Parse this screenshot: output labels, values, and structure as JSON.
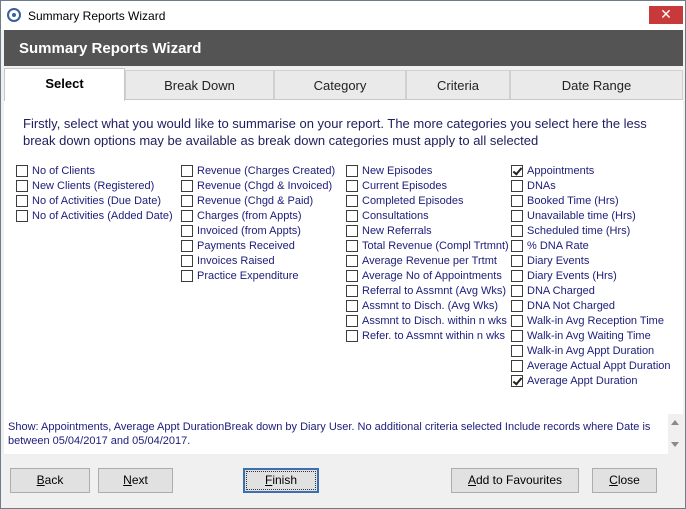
{
  "window": {
    "title": "Summary Reports Wizard",
    "close_glyph": "✕"
  },
  "header": {
    "title": "Summary Reports Wizard"
  },
  "tabs": [
    {
      "label": "Select",
      "active": true
    },
    {
      "label": "Break Down",
      "active": false
    },
    {
      "label": "Category",
      "active": false
    },
    {
      "label": "Criteria",
      "active": false
    },
    {
      "label": "Date Range",
      "active": false
    }
  ],
  "intro": "Firstly, select what you would like to summarise on your report. The more categories you select here the less break down options may be available as break down categories must apply to all selected",
  "columns": [
    [
      {
        "label": "No of Clients",
        "checked": false
      },
      {
        "label": "New Clients (Registered)",
        "checked": false
      },
      {
        "label": "No of Activities (Due Date)",
        "checked": false
      },
      {
        "label": "No of Activities (Added Date)",
        "checked": false
      }
    ],
    [
      {
        "label": "Revenue (Charges Created)",
        "checked": false
      },
      {
        "label": "Revenue (Chgd & Invoiced)",
        "checked": false
      },
      {
        "label": "Revenue (Chgd & Paid)",
        "checked": false
      },
      {
        "label": "Charges (from Appts)",
        "checked": false
      },
      {
        "label": "Invoiced (from Appts)",
        "checked": false
      },
      {
        "label": "Payments Received",
        "checked": false
      },
      {
        "label": "Invoices Raised",
        "checked": false
      },
      {
        "label": "Practice Expenditure",
        "checked": false
      }
    ],
    [
      {
        "label": "New Episodes",
        "checked": false
      },
      {
        "label": "Current Episodes",
        "checked": false
      },
      {
        "label": "Completed Episodes",
        "checked": false
      },
      {
        "label": "Consultations",
        "checked": false
      },
      {
        "label": "New Referrals",
        "checked": false
      },
      {
        "label": "Total Revenue (Compl Trtmnt)",
        "checked": false
      },
      {
        "label": "Average Revenue per Trtmt",
        "checked": false
      },
      {
        "label": "Average No of Appointments",
        "checked": false
      },
      {
        "label": "Referral to Assmnt (Avg Wks)",
        "checked": false
      },
      {
        "label": "Assmnt to Disch. (Avg Wks)",
        "checked": false
      },
      {
        "label": "Assmnt to Disch. within n wks",
        "checked": false
      },
      {
        "label": "Refer. to Assmnt within n wks",
        "checked": false
      }
    ],
    [
      {
        "label": "Appointments",
        "checked": true
      },
      {
        "label": "DNAs",
        "checked": false
      },
      {
        "label": "Booked Time (Hrs)",
        "checked": false
      },
      {
        "label": "Unavailable time (Hrs)",
        "checked": false
      },
      {
        "label": "Scheduled time (Hrs)",
        "checked": false
      },
      {
        "label": "% DNA Rate",
        "checked": false
      },
      {
        "label": "Diary Events",
        "checked": false
      },
      {
        "label": "Diary Events (Hrs)",
        "checked": false
      },
      {
        "label": "DNA Charged",
        "checked": false
      },
      {
        "label": "DNA Not Charged",
        "checked": false
      },
      {
        "label": "Walk-in Avg Reception Time",
        "checked": false
      },
      {
        "label": "Walk-in Avg Waiting Time",
        "checked": false
      },
      {
        "label": "Walk-in Avg Appt Duration",
        "checked": false
      },
      {
        "label": "Average Actual Appt Duration",
        "checked": false
      },
      {
        "label": "Average Appt Duration",
        "checked": true
      }
    ]
  ],
  "summary": "Show: Appointments, Average Appt DurationBreak down by Diary User. No additional criteria selected Include records where Date is between 05/04/2017 and 05/04/2017.",
  "buttons": {
    "back": {
      "mnemonic": "B",
      "rest": "ack"
    },
    "next": {
      "mnemonic": "N",
      "rest": "ext"
    },
    "finish": {
      "mnemonic": "F",
      "rest": "inish"
    },
    "favourites": {
      "mnemonic": "A",
      "rest": "dd to Favourites"
    },
    "close": {
      "mnemonic": "C",
      "rest": "lose"
    }
  },
  "colors": {
    "header_band": "#545454",
    "title_close": "#c7393a",
    "label_text": "#1c1c7a",
    "default_button_border": "#3a6fb0"
  }
}
